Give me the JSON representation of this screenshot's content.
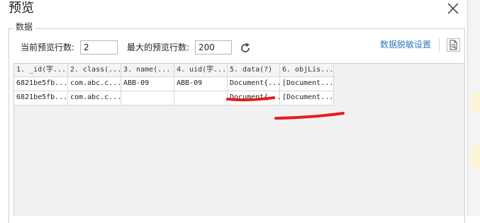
{
  "window": {
    "title": "预览"
  },
  "group": {
    "label": "数据"
  },
  "settings": {
    "current_rows_label": "当前预览行数:",
    "current_rows_value": "2",
    "max_rows_label": "最大的预览行数:",
    "max_rows_value": "200",
    "masking_link": "数据脱敏设置"
  },
  "table": {
    "columns": [
      "1. _id(字...",
      "2. class(...",
      "3. name(...",
      "4. uid(字...",
      "5. data(?)",
      "6. objLis..."
    ],
    "rows": [
      [
        "6821be5fb...",
        "com.abc.c...",
        "ABB-09",
        "ABB-09",
        "Document{...",
        "[Document..."
      ],
      [
        "6821be5fb...",
        "com.abc.c...",
        "",
        "",
        "Document{...",
        "[Document..."
      ]
    ]
  },
  "colors": {
    "link": "#2e79c6",
    "annotation": "#e41e1e"
  },
  "icons": {
    "close": "close-icon",
    "refresh": "refresh-icon",
    "preview": "document-preview-icon"
  }
}
